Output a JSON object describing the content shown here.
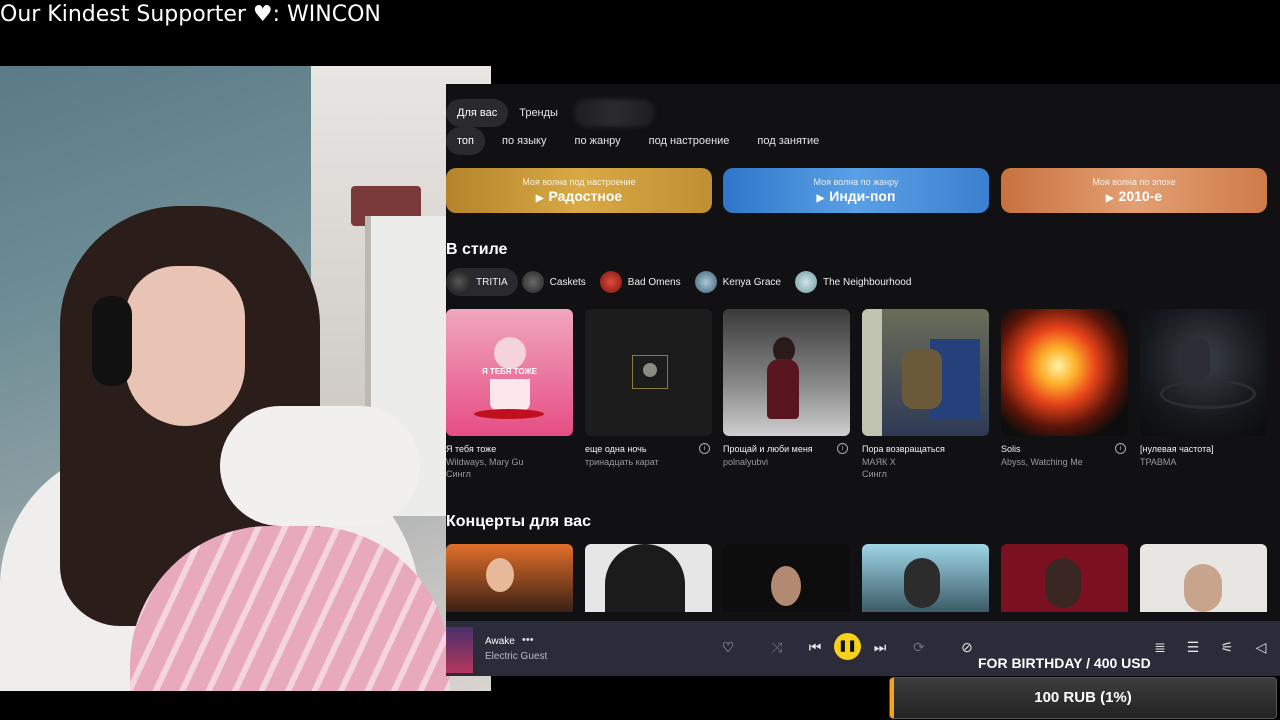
{
  "overlay": {
    "supporter_prefix": "Our Kindest Supporter ",
    "heart": "♥",
    "supporter_suffix": ": WINCON"
  },
  "tabs": [
    {
      "label": "Для вас",
      "active": true
    },
    {
      "label": "Тренды",
      "active": false
    }
  ],
  "filters": [
    {
      "label": "топ",
      "active": true
    },
    {
      "label": "по языку",
      "active": false
    },
    {
      "label": "по жанру",
      "active": false
    },
    {
      "label": "под настроение",
      "active": false
    },
    {
      "label": "под занятие",
      "active": false
    }
  ],
  "waves": [
    {
      "subtitle": "Моя волна под настроение",
      "title": "Радостное",
      "color": "#c9962f"
    },
    {
      "subtitle": "Моя волна по жанру",
      "title": "Инди-поп",
      "color": "#3f86d3"
    },
    {
      "subtitle": "Моя волна по эпохе",
      "title": "2010-е",
      "color": "#d5834e"
    }
  ],
  "style_section": {
    "title": "В стиле",
    "artists": [
      {
        "name": "TRITIA",
        "active": true
      },
      {
        "name": "Caskets",
        "active": false
      },
      {
        "name": "Bad Omens",
        "active": false
      },
      {
        "name": "Kenya Grace",
        "active": false
      },
      {
        "name": "The Neighbourhood",
        "active": false
      }
    ],
    "cover_text": "Я ТЕБЯ ТОЖЕ",
    "cards": [
      {
        "title": "Я тебя тоже",
        "artist": "Wildways, Mary Gu",
        "type": "Сингл",
        "info": false
      },
      {
        "title": "еще одна ночь",
        "artist": "тринадцать карат",
        "type": "",
        "info": true
      },
      {
        "title": "Прощай и люби меня",
        "artist": "polnalyubvi",
        "type": "",
        "info": true
      },
      {
        "title": "Пора возвращаться",
        "artist": "МАЯК X",
        "type": "Сингл",
        "info": false
      },
      {
        "title": "Solis",
        "artist": "Abyss, Watching Me",
        "type": "",
        "info": true
      },
      {
        "title": "[нулевая частота]",
        "artist": "ТРАВМА",
        "type": "",
        "info": false
      }
    ]
  },
  "concerts_section": {
    "title": "Концерты для вас"
  },
  "player": {
    "track": "Awake",
    "more": "•••",
    "artist": "Electric Guest",
    "icons": {
      "like": "heart-icon",
      "shuffle": "shuffle-icon",
      "prev": "previous-icon",
      "pause": "pause-icon",
      "next": "next-icon",
      "repeat": "repeat-icon",
      "dislike": "dislike-icon",
      "lyrics": "lyrics-icon",
      "queue": "queue-icon",
      "settings": "equalizer-icon",
      "volume": "volume-icon"
    },
    "accent": "#f7d21b"
  },
  "goal": {
    "title": "FOR BIRTHDAY / 400 USD",
    "progress_label": "100 RUB (1%)",
    "progress_fraction": 0.01,
    "color": "#f7a21b"
  }
}
